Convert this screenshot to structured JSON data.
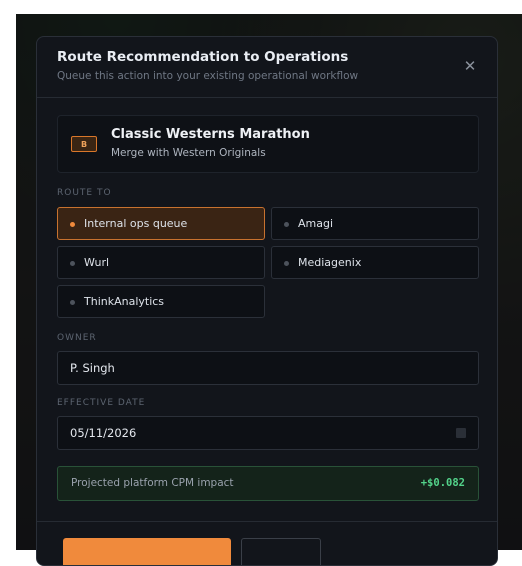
{
  "modal": {
    "title": "Route Recommendation to Operations",
    "subtitle": "Queue this action into your existing operational workflow",
    "close_icon": "close-icon",
    "close_glyph": "✕"
  },
  "item": {
    "badge": "B",
    "title": "Classic Westerns Marathon",
    "subtitle": "Merge with Western Originals"
  },
  "route": {
    "label": "ROUTE TO",
    "selected": "Internal ops queue",
    "options": [
      {
        "label": "Internal ops queue",
        "selected": true
      },
      {
        "label": "Amagi",
        "selected": false
      },
      {
        "label": "Wurl",
        "selected": false
      },
      {
        "label": "Mediagenix",
        "selected": false
      },
      {
        "label": "ThinkAnalytics",
        "selected": false
      }
    ]
  },
  "owner": {
    "label": "OWNER",
    "value": "P. Singh"
  },
  "effective_date": {
    "label": "EFFECTIVE DATE",
    "value": "05/11/2026",
    "icon": "calendar-icon"
  },
  "impact": {
    "label": "Projected platform CPM impact",
    "value": "+$0.082"
  },
  "colors": {
    "accent": "#f08a3c",
    "positive": "#53d38a",
    "surface": "#12151b"
  }
}
